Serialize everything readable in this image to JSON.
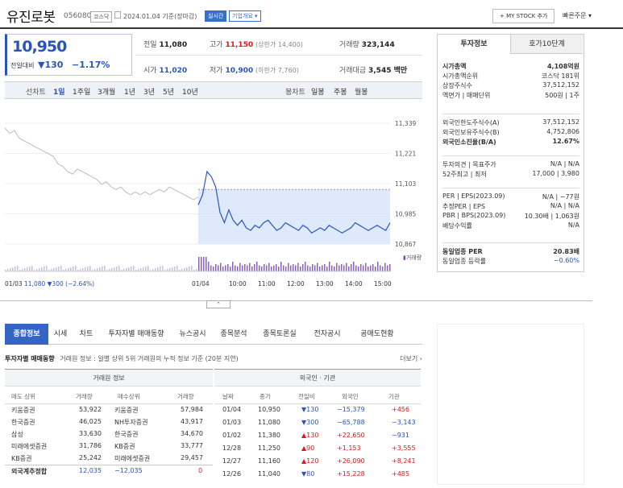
{
  "header": {
    "name": "유진로봇",
    "code": "056080",
    "market": "코스닥",
    "date": "2024.01.04 기준(장마감)",
    "realtime": "실시간",
    "company_info": "기업개요 ▾",
    "mystock": "+ MY STOCK 추가",
    "quick_order": "빠른주문 ▾"
  },
  "price": {
    "current": "10,950",
    "change_label": "전일대비",
    "change": "▼130",
    "rate": "−1.17%"
  },
  "summary": {
    "prev_label": "전일",
    "prev": "11,080",
    "high_label": "고가",
    "high": "11,150",
    "high_limit": "(상한가 14,400)",
    "volume_label": "거래량",
    "volume": "323,144",
    "open_label": "시가",
    "open": "11,020",
    "low_label": "저가",
    "low": "10,900",
    "low_limit": "(하한가 7,760)",
    "amount_label": "거래대금",
    "amount": "3,545 백만"
  },
  "periods": {
    "line": "선차트",
    "items": [
      "1일",
      "1주일",
      "3개월",
      "1년",
      "3년",
      "5년",
      "10년"
    ],
    "candle": "봉차트",
    "c_items": [
      "일봉",
      "주봉",
      "월봉"
    ]
  },
  "chart": {
    "yticks": [
      "11,339",
      "11,221",
      "11,103",
      "10,985",
      "10,867"
    ],
    "volume_label": "거래량",
    "xticks": [
      "01/04",
      "10:00",
      "11:00",
      "12:00",
      "13:00",
      "14:00",
      "15:00"
    ],
    "prev_info_date": "01/03",
    "prev_info_price": "11,080",
    "prev_info_change": "▼300",
    "prev_info_rate": "(−2.64%)"
  },
  "chart_data": {
    "type": "line",
    "ylim": [
      10867,
      11339
    ],
    "yticks": [
      11339,
      11221,
      11103,
      10985,
      10867
    ],
    "prev_day": [
      11320,
      11300,
      11310,
      11280,
      11270,
      11260,
      11250,
      11240,
      11230,
      11220,
      11210,
      11180,
      11170,
      11150,
      11140,
      11160,
      11150,
      11140,
      11130,
      11120,
      11100,
      11110,
      11090,
      11080,
      11090,
      11070,
      11060,
      11070,
      11060,
      11070,
      11060,
      11070,
      11080,
      11070,
      11090,
      11080,
      11070,
      11060,
      11050,
      11040,
      11050
    ],
    "today": [
      11020,
      11060,
      11150,
      11130,
      11090,
      10990,
      10950,
      11000,
      10960,
      10940,
      10960,
      10930,
      10920,
      10940,
      10930,
      10950,
      10960,
      10940,
      10920,
      10930,
      10950,
      10940,
      10930,
      10920,
      10940,
      10930,
      10910,
      10920,
      10930,
      10920,
      10940,
      10930,
      10920,
      10910,
      10920,
      10930,
      10950,
      10940,
      10930,
      10920,
      10930,
      10940,
      10930,
      10920,
      10950
    ],
    "reference": 11080
  },
  "invest": {
    "tab1": "투자정보",
    "tab2": "호가10단계",
    "rows1": [
      [
        "시가총액",
        "4,108억원"
      ],
      [
        "시가총액순위",
        "코스닥 181위"
      ],
      [
        "상장주식수",
        "37,512,152"
      ],
      [
        "액면가 | 매매단위",
        "500원 | 1주"
      ]
    ],
    "rows2": [
      [
        "외국인한도주식수(A)",
        "37,512,152"
      ],
      [
        "외국인보유주식수(B)",
        "4,752,806"
      ],
      [
        "외국인소진율(B/A)",
        "12.67%"
      ]
    ],
    "rows3": [
      [
        "투자의견 | 목표주가",
        "N/A | N/A"
      ],
      [
        "52주최고 | 최저",
        "17,000 | 3,980"
      ]
    ],
    "rows4": [
      [
        "PER | EPS(2023.09)",
        "N/A | −77원"
      ],
      [
        "추정PER | EPS",
        "N/A | N/A"
      ],
      [
        "PBR | BPS(2023.09)",
        "10.30배 | 1,063원"
      ],
      [
        "배당수익률",
        "N/A"
      ]
    ],
    "rows5": [
      [
        "동일업종 PER",
        "20.83배"
      ],
      [
        "동일업종 등락률",
        "−0.60%"
      ]
    ]
  },
  "tabs": [
    "종합정보",
    "시세",
    "차트",
    "투자자별 매매동향",
    "뉴스공시",
    "종목분석",
    "종목토론실",
    "전자공시",
    "공매도현황"
  ],
  "trading": {
    "title": "투자자별 매매동향",
    "desc": "거래원 정보 : 일별 상위 5위 거래원의 누적 정보 기준 (20분 지연)",
    "more": "더보기 ›",
    "broker_title": "거래원 정보",
    "foreign_title": "외국인 · 기관",
    "broker_cols": [
      "매도 상위",
      "거래량",
      "매수상위",
      "거래량"
    ],
    "brokers": [
      [
        "키움증권",
        "53,922",
        "키움증권",
        "57,984"
      ],
      [
        "한국증권",
        "46,025",
        "NH투자증권",
        "43,917"
      ],
      [
        "삼성",
        "33,630",
        "한국증권",
        "34,670"
      ],
      [
        "미래에셋증권",
        "31,786",
        "KB증권",
        "33,777"
      ],
      [
        "KB증권",
        "25,242",
        "미래에셋증권",
        "29,457"
      ]
    ],
    "broker_total": [
      "외국계추정합",
      "12,035",
      "−12,035",
      "0"
    ],
    "foreign_cols": [
      "날짜",
      "종가",
      "전일비",
      "외국인",
      "기관"
    ],
    "foreign": [
      [
        "01/04",
        "10,950",
        "▼130",
        "−15,379",
        "+456"
      ],
      [
        "01/03",
        "11,080",
        "▼300",
        "−65,788",
        "−3,143"
      ],
      [
        "01/02",
        "11,380",
        "▲130",
        "+22,650",
        "−931"
      ],
      [
        "12/28",
        "11,250",
        "▲90",
        "+1,153",
        "+3,555"
      ],
      [
        "12/27",
        "11,160",
        "▲120",
        "+26,090",
        "+8,241"
      ],
      [
        "12/26",
        "11,040",
        "▼80",
        "+15,228",
        "+485"
      ]
    ]
  }
}
